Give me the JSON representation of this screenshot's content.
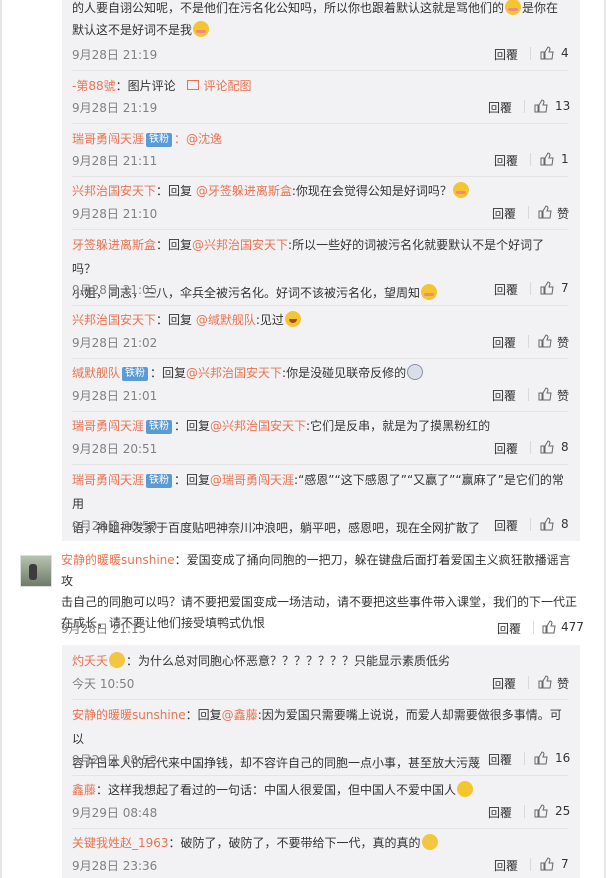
{
  "reply_block_1": [
    {
      "text_lines": [
        "的人要自诩公知呢，不是他们在污名化公知吗，所以你也跟着默认这就是骂他们的",
        "是你在默认这不是好词不是我"
      ],
      "time": "9月28日 21:19",
      "reply_label": "回覆",
      "likes": "4"
    },
    {
      "user": "-第88號",
      "body": "：图片评论",
      "link": "评论配图",
      "time": "9月28日 21:19",
      "reply_label": "回覆",
      "likes": "13"
    },
    {
      "user": "瑞哥勇闯天涯",
      "badge": "铁粉",
      "mention": "：@沈逸",
      "time": "9月28日 21:11",
      "reply_label": "回覆",
      "likes": "1"
    },
    {
      "user": "兴邦治国安天下",
      "pre": "：回复 ",
      "mention": "@牙签躲进离斯盒",
      "body": ":你现在会觉得公知是好词吗？",
      "time": "9月28日 21:10",
      "reply_label": "回覆",
      "likes": "赞"
    },
    {
      "user": "牙签躲进离斯盒",
      "pre": "：回复",
      "mention": "@兴邦治国安天下",
      "body": ":所以一些好的词被污名化就要默认不是个好词了吗？",
      "line2": "小姐，同志，三八，伞兵全被污名化。好词不该被污名化，望周知",
      "time": "9月28日 21:05",
      "reply_label": "回覆",
      "likes": "7"
    },
    {
      "user": "兴邦治国安天下",
      "pre": "：回复 ",
      "mention": "@缄默舰队",
      "body": ":见过",
      "time": "9月28日 21:02",
      "reply_label": "回覆",
      "likes": "赞"
    },
    {
      "user": "缄默舰队",
      "badge": "铁粉",
      "pre": "：回复",
      "mention": "@兴邦治国安天下",
      "body": ":你是没碰见联帝反修的",
      "time": "9月28日 21:01",
      "reply_label": "回覆",
      "likes": "赞"
    },
    {
      "user": "瑞哥勇闯天涯",
      "badge": "铁粉",
      "pre": "：回复",
      "mention": "@兴邦治国安天下",
      "body": ":它们是反串，就是为了摸黑粉红的",
      "time": "9月28日 20:51",
      "reply_label": "回覆",
      "likes": "8"
    },
    {
      "user": "瑞哥勇闯天涯",
      "badge": "铁粉",
      "pre": "：回复",
      "mention": "@瑞哥勇闯天涯",
      "body": ":“感恩”“这下感恩了”“又赢了”“赢麻了”是它们的常用",
      "line2": "语，神蛆神发家于百度贴吧神奈川冲浪吧，躺平吧，感恩吧，现在全网扩散了",
      "time": "9月28日 20:50",
      "reply_label": "回覆",
      "likes": "8"
    }
  ],
  "main_comment": {
    "user": "安静的暖暖sunshine",
    "body1": "：爱国变成了捅向同胞的一把刀，躲在键盘后面打着爱国主义疯狂散播谣言攻",
    "body2": "击自己的同胞可以吗？请不要把爱国变成一场洁动，请不要把这些事件带入课堂，我们的下一代正",
    "body3": "在成长，请不要让他们接受填鸭式仇恨",
    "time": "9月28日 21:15",
    "reply_label": "回覆",
    "likes": "477"
  },
  "reply_block_2": [
    {
      "user": "灼夭夭",
      "body": "：为什么总对同胞心怀恶意？？？？？？？只能显示素质低劣",
      "time": "今天 10:50",
      "reply_label": "回覆",
      "likes": "赞"
    },
    {
      "user": "安静的暖暖sunshine",
      "pre": "：回复",
      "mention": "@鑫藤",
      "body": ":因为爱国只需要嘴上说说，而爱人却需要做很多事情。可以",
      "line2": "容许日本人的后代来中国挣钱，却不容许自己的同胞一点小事，甚至放大污蔑",
      "time": "9月29日 08:52",
      "reply_label": "回覆",
      "likes": "16"
    },
    {
      "user": "鑫藤",
      "body": "：这样我想起了看过的一句话：中国人很爱国，但中国人不爱中国人",
      "time": "9月29日 08:48",
      "reply_label": "回覆",
      "likes": "25"
    },
    {
      "user": "关键我姓赵_1963",
      "body": "：破防了，破防了，不要带给下一代，真的真的",
      "time": "9月28日 23:36",
      "reply_label": "回覆",
      "likes": "7"
    }
  ]
}
